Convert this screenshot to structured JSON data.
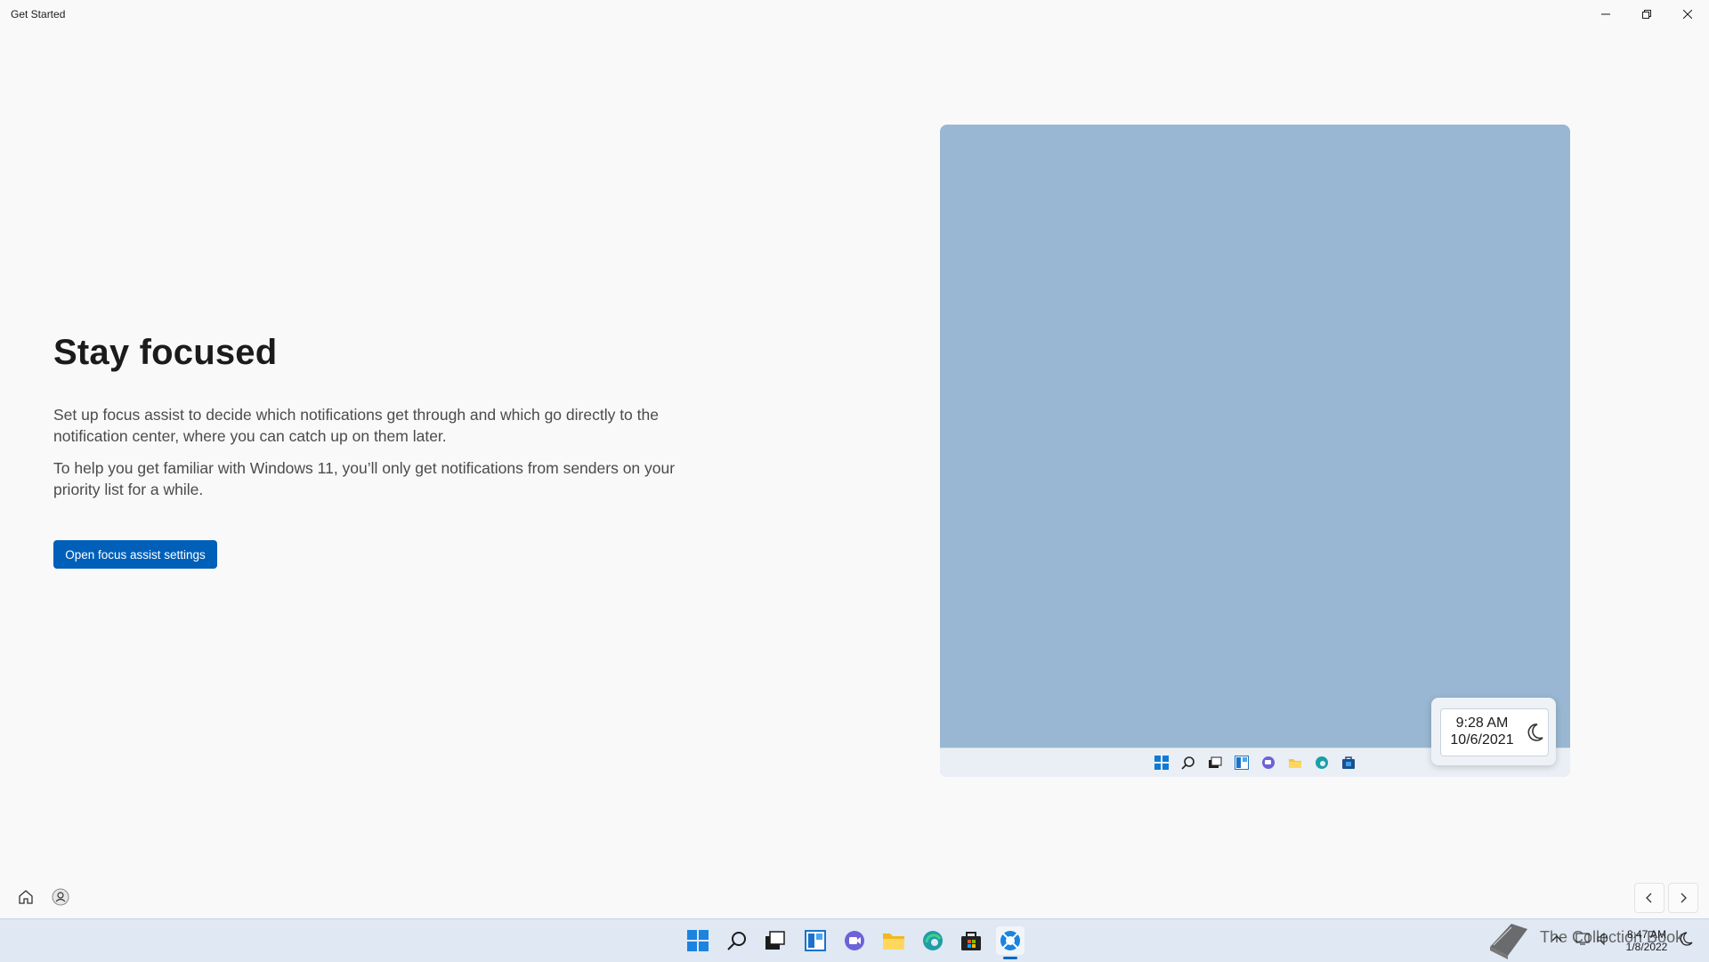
{
  "window": {
    "title": "Get Started"
  },
  "page": {
    "heading": "Stay focused",
    "paragraph1": "Set up focus assist to decide which notifications get through and which go directly to the notification center, where you can catch up on them later.",
    "paragraph2": "To help you get familiar with Windows 11, you’ll only get notifications from senders on your priority list for a while.",
    "button_label": "Open focus assist settings",
    "accent": "#005fb8"
  },
  "illustration": {
    "background": "#99b7d2",
    "focus_time": "9:28 AM",
    "focus_date": "10/6/2021",
    "taskbar_icons": [
      "start-icon",
      "search-icon",
      "task-view-icon",
      "widgets-icon",
      "chat-icon",
      "file-explorer-icon",
      "edge-icon",
      "store-icon"
    ]
  },
  "app_nav": {
    "icons": [
      "home-icon",
      "account-icon"
    ],
    "pager": [
      "previous-icon",
      "next-icon"
    ]
  },
  "taskbar": {
    "icons": [
      "start-icon",
      "search-icon",
      "task-view-icon",
      "widgets-icon",
      "chat-icon",
      "file-explorer-icon",
      "edge-icon",
      "store-icon",
      "get-started-icon"
    ],
    "watermark": "The Collection Book",
    "clock_time": "8:47 AM",
    "clock_date": "1/8/2022"
  }
}
